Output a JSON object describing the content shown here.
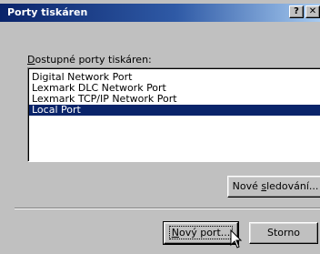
{
  "window": {
    "title": "Porty tiskáren",
    "help_button": "?",
    "close_button": "✕"
  },
  "list": {
    "label_prefix": "",
    "label_mnemonic": "D",
    "label_rest": "ostupné porty tiskáren:",
    "items": [
      {
        "label": "Digital Network Port",
        "selected": false
      },
      {
        "label": "Lexmark DLC Network Port",
        "selected": false
      },
      {
        "label": "Lexmark TCP/IP Network Port",
        "selected": false
      },
      {
        "label": "Local Port",
        "selected": true
      }
    ]
  },
  "buttons": {
    "new_monitor_prefix": "Nové ",
    "new_monitor_mnemonic": "s",
    "new_monitor_rest": "ledování...",
    "new_port_prefix": "",
    "new_port_mnemonic": "N",
    "new_port_rest": "ový port...",
    "cancel": "Storno"
  }
}
